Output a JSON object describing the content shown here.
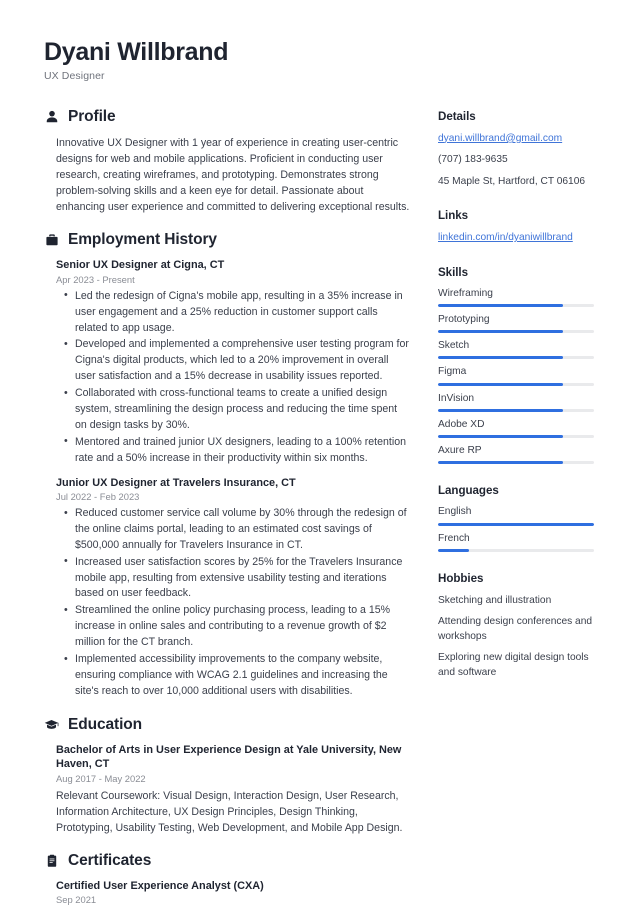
{
  "header": {
    "name": "Dyani Willbrand",
    "job_title": "UX Designer"
  },
  "accent_color": "#2f6fe0",
  "text_color": "#2b2e3a",
  "muted_color": "#8a8d95",
  "link_color": "#3f74d8",
  "sections": {
    "profile": {
      "title": "Profile",
      "icon": "user-icon",
      "text": "Innovative UX Designer with 1 year of experience in creating user-centric designs for web and mobile applications. Proficient in conducting user research, creating wireframes, and prototyping. Demonstrates strong problem-solving skills and a keen eye for detail. Passionate about enhancing user experience and committed to delivering exceptional results."
    },
    "employment": {
      "title": "Employment History",
      "icon": "briefcase-icon",
      "entries": [
        {
          "title": "Senior UX Designer at Cigna, CT",
          "date": "Apr 2023 - Present",
          "bullets": [
            "Led the redesign of Cigna's mobile app, resulting in a 35% increase in user engagement and a 25% reduction in customer support calls related to app usage.",
            "Developed and implemented a comprehensive user testing program for Cigna's digital products, which led to a 20% improvement in overall user satisfaction and a 15% decrease in usability issues reported.",
            "Collaborated with cross-functional teams to create a unified design system, streamlining the design process and reducing the time spent on design tasks by 30%.",
            "Mentored and trained junior UX designers, leading to a 100% retention rate and a 50% increase in their productivity within six months."
          ]
        },
        {
          "title": "Junior UX Designer at Travelers Insurance, CT",
          "date": "Jul 2022 - Feb 2023",
          "bullets": [
            "Reduced customer service call volume by 30% through the redesign of the online claims portal, leading to an estimated cost savings of $500,000 annually for Travelers Insurance in CT.",
            "Increased user satisfaction scores by 25% for the Travelers Insurance mobile app, resulting from extensive usability testing and iterations based on user feedback.",
            "Streamlined the online policy purchasing process, leading to a 15% increase in online sales and contributing to a revenue growth of $2 million for the CT branch.",
            "Implemented accessibility improvements to the company website, ensuring compliance with WCAG 2.1 guidelines and increasing the site's reach to over 10,000 additional users with disabilities."
          ]
        }
      ]
    },
    "education": {
      "title": "Education",
      "icon": "graduation-cap-icon",
      "entries": [
        {
          "title": "Bachelor of Arts in User Experience Design at Yale University, New Haven, CT",
          "date": "Aug 2017 - May 2022",
          "description": "Relevant Coursework: Visual Design, Interaction Design, User Research, Information Architecture, UX Design Principles, Design Thinking, Prototyping, Usability Testing, Web Development, and Mobile App Design."
        }
      ]
    },
    "certificates": {
      "title": "Certificates",
      "icon": "clipboard-icon",
      "entries": [
        {
          "title": "Certified User Experience Analyst (CXA)",
          "date": "Sep 2021"
        }
      ]
    }
  },
  "sidebar": {
    "details": {
      "title": "Details",
      "email": "dyani.willbrand@gmail.com",
      "phone": "(707) 183-9635",
      "address": "45 Maple St, Hartford, CT 06106"
    },
    "links": {
      "title": "Links",
      "items": [
        {
          "label": "linkedin.com/in/dyaniwillbrand"
        }
      ]
    },
    "skills": {
      "title": "Skills",
      "items": [
        {
          "label": "Wireframing",
          "level": 80
        },
        {
          "label": "Prototyping",
          "level": 80
        },
        {
          "label": "Sketch",
          "level": 80
        },
        {
          "label": "Figma",
          "level": 80
        },
        {
          "label": "InVision",
          "level": 80
        },
        {
          "label": "Adobe XD",
          "level": 80
        },
        {
          "label": "Axure RP",
          "level": 80
        }
      ]
    },
    "languages": {
      "title": "Languages",
      "items": [
        {
          "label": "English",
          "level": 100
        },
        {
          "label": "French",
          "level": 20
        }
      ]
    },
    "hobbies": {
      "title": "Hobbies",
      "items": [
        {
          "label": "Sketching and illustration"
        },
        {
          "label": "Attending design conferences and workshops"
        },
        {
          "label": "Exploring new digital design tools and software"
        }
      ]
    }
  }
}
